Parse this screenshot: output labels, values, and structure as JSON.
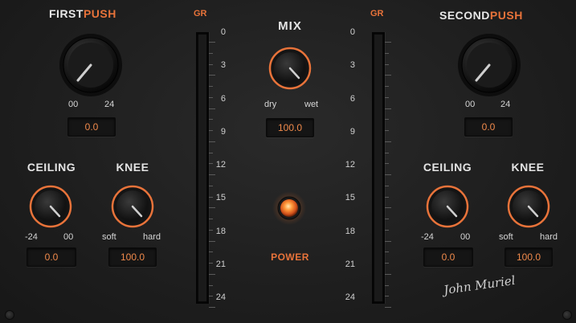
{
  "first_push": {
    "title_white": "FIRST",
    "title_orange": "PUSH",
    "range_min": "00",
    "range_max": "24",
    "value": "0.0",
    "ceiling": {
      "label": "CEILING",
      "min": "-24",
      "max": "00",
      "value": "0.0"
    },
    "knee": {
      "label": "KNEE",
      "min": "soft",
      "max": "hard",
      "value": "100.0"
    }
  },
  "second_push": {
    "title_white": "SECOND",
    "title_orange": "PUSH",
    "range_min": "00",
    "range_max": "24",
    "value": "0.0",
    "ceiling": {
      "label": "CEILING",
      "min": "-24",
      "max": "00",
      "value": "0.0"
    },
    "knee": {
      "label": "KNEE",
      "min": "soft",
      "max": "hard",
      "value": "100.0"
    }
  },
  "meters": {
    "left_label": "GR",
    "right_label": "GR",
    "scale": [
      "0",
      "3",
      "6",
      "9",
      "12",
      "15",
      "18",
      "21",
      "24"
    ]
  },
  "mix": {
    "label": "MIX",
    "min": "dry",
    "max": "wet",
    "value": "100.0"
  },
  "power": {
    "label": "POWER"
  },
  "signature": "John Muriel",
  "colors": {
    "accent": "#e8733a",
    "value_text": "#f08a4b",
    "background": "#202020"
  }
}
